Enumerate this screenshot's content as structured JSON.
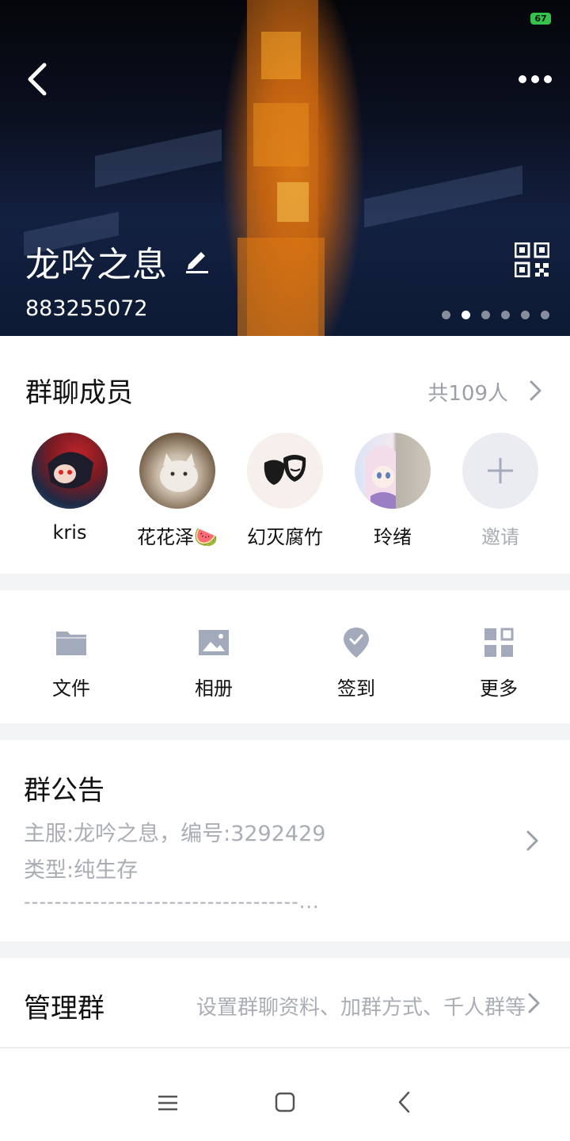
{
  "status_bar": {
    "battery": "67"
  },
  "header": {
    "group_name": "龙吟之息",
    "group_id": "883255072",
    "page_dots": 6,
    "active_dot": 1
  },
  "members": {
    "title": "群聊成员",
    "count": "共109人",
    "list": [
      {
        "name": "kris"
      },
      {
        "name": "花花泽🍉"
      },
      {
        "name": "幻灭腐竹"
      },
      {
        "name": "玲绪"
      }
    ],
    "invite_label": "邀请"
  },
  "tools": {
    "files": "文件",
    "album": "相册",
    "checkin": "签到",
    "more": "更多"
  },
  "notice": {
    "title": "群公告",
    "line1": "主服:龙吟之息，编号:3292429",
    "line2": "类型:纯生存",
    "line3": "------------------------------------...",
    "separator_glyph": "..."
  },
  "manage": {
    "title": "管理群",
    "desc": "设置群聊资料、加群方式、千人群等"
  },
  "colors": {
    "icon_gray": "#a3aabb",
    "muted_text": "#a9aeb5",
    "section_gap": "#f3f4f6"
  }
}
